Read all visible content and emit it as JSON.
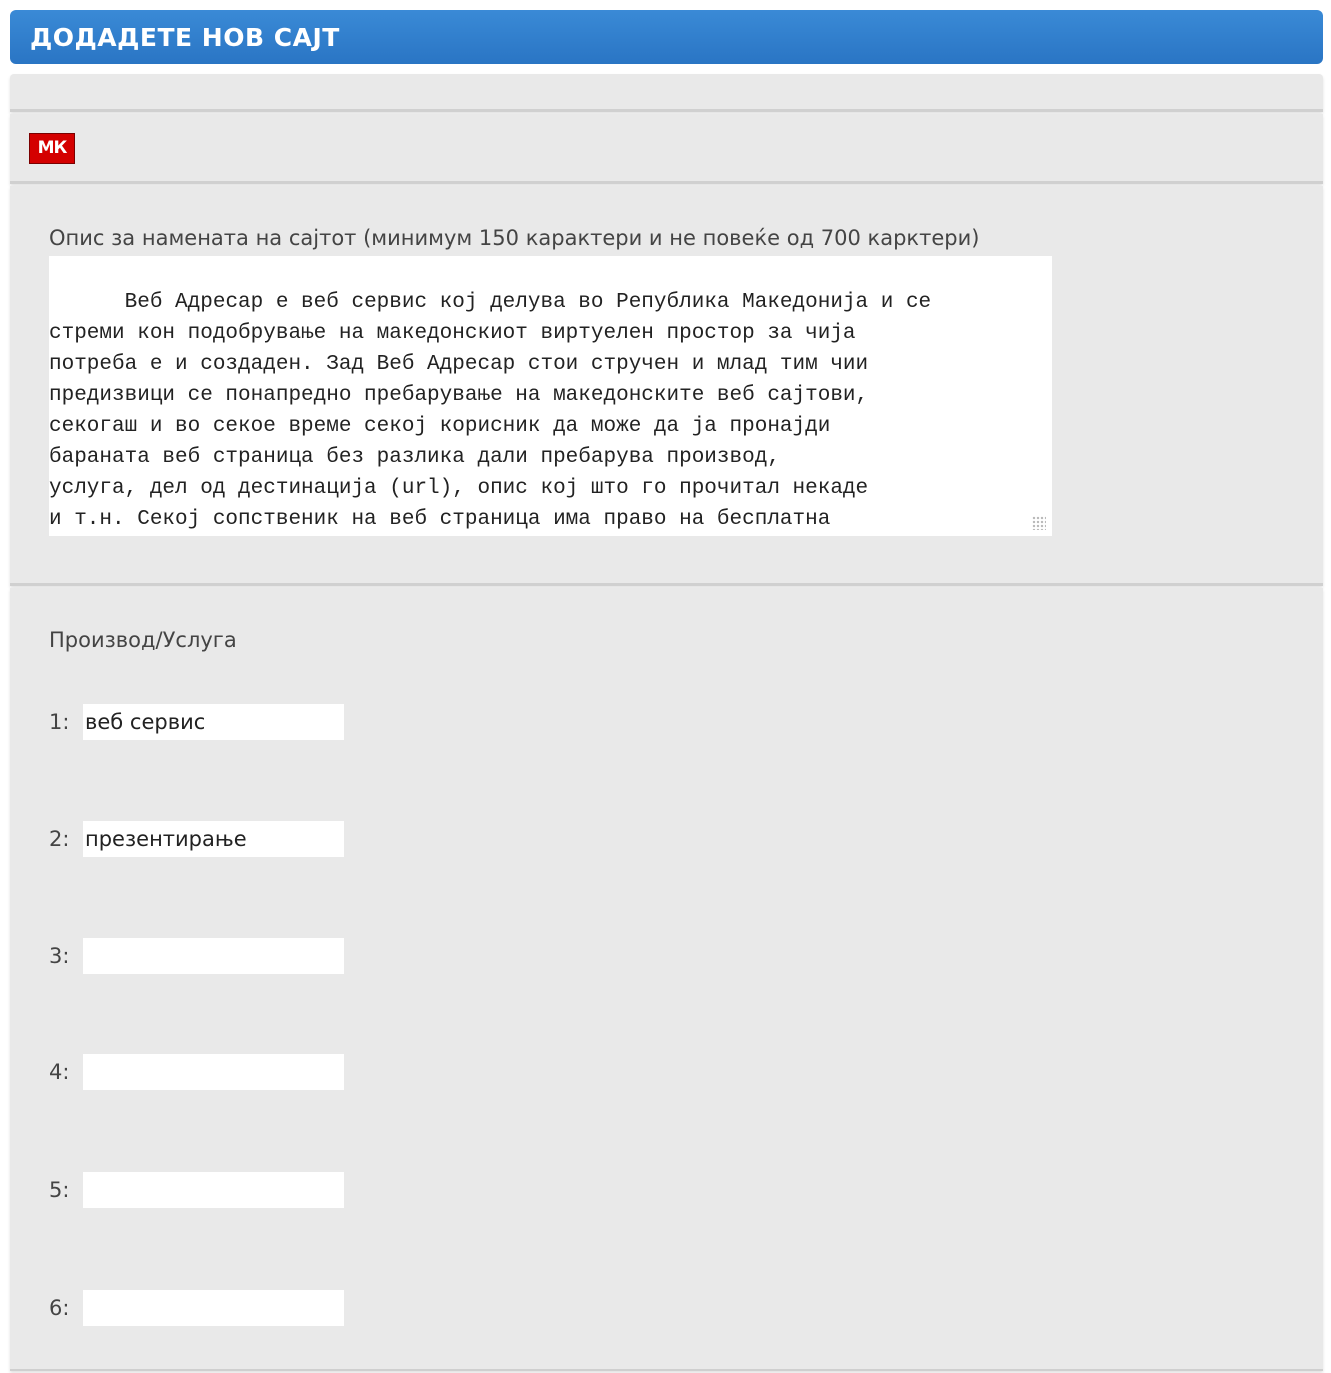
{
  "header": {
    "title": "ДОДАДЕТЕ НОВ САЈТ"
  },
  "language": {
    "flag_label": "МК",
    "flag_color": "#d40000"
  },
  "description": {
    "label": "Опис за намената на сајтот (минимум 150 карактери и не повеќе од 700 карктери)",
    "value": "Веб Адресар е веб сервис кој делува во Република Македонија и се\nстреми кон подобрување на македонскиот виртуелен простор за чија\nпотреба е и создаден. Зад Веб Адресар стои стручен и млад тим чии\nпредизвици се понапредно пребарување на македонските веб сајтови,\nсекогаш и во секое време секој корисник да може да ја пронајди\nбараната веб страница без разлика дали пребарува производ,\nуслуга, дел од дестинација (url), опис кој што го прочитал некаде\nи т.н. Секој сопственик на веб страница има право на бесплатна\nпрезентација во склопот на Веб Адресар."
  },
  "products": {
    "label": "Производ/Услуга",
    "fields": [
      {
        "number": "1:",
        "value": "веб сервис"
      },
      {
        "number": "2:",
        "value": "презентирање"
      },
      {
        "number": "3:",
        "value": ""
      },
      {
        "number": "4:",
        "value": ""
      },
      {
        "number": "5:",
        "value": ""
      },
      {
        "number": "6:",
        "value": ""
      }
    ]
  },
  "colors": {
    "header_bg": "#2a75c4",
    "panel_bg": "#e9e9e9",
    "input_bg": "#ffffff"
  }
}
